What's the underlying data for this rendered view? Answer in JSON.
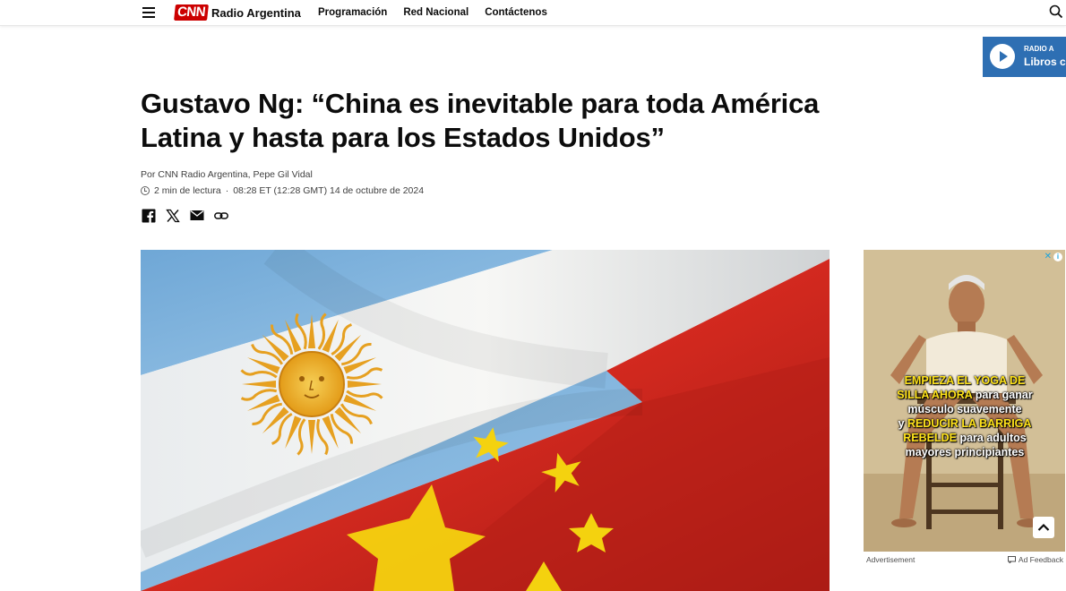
{
  "header": {
    "logo_brand": "CNN",
    "logo_text": "Radio Argentina",
    "nav": [
      "Programación",
      "Red Nacional",
      "Contáctenos"
    ]
  },
  "radio_widget": {
    "small_label": "RADIO A",
    "big_label": "Libros c"
  },
  "article": {
    "headline": "Gustavo Ng: “China es inevitable para toda América Latina y hasta para los Estados Unidos”",
    "byline_prefix": "Por ",
    "byline_authors": "CNN Radio Argentina, Pepe Gil Vidal",
    "read_time": "2 min de lectura",
    "separator": "·",
    "published": "08:28 ET (12:28 GMT) 14 de octubre de 2024"
  },
  "share_icons": [
    "facebook-icon",
    "x-icon",
    "email-icon",
    "link-icon"
  ],
  "ad": {
    "line1_hl": "EMPIEZA EL YOGA DE",
    "line2_hl": "SILLA AHORA",
    "line2_rest": " para ganar",
    "line3": "músculo suavemente",
    "line4_pre": "y ",
    "line4_hl": "REDUCIR LA BARRIGA",
    "line5_hl": "REBELDE",
    "line5_rest": " para adultos",
    "line6": "mayores principiantes",
    "advertisement_label": "Advertisement",
    "feedback_label": "Ad Feedback"
  },
  "colors": {
    "cnn_red": "#cc0000",
    "radio_blue": "#2e6fb3",
    "flag_argentina_blue": "#7fb3dd",
    "flag_china_red": "#c5231b",
    "star_yellow": "#f4d20f"
  }
}
